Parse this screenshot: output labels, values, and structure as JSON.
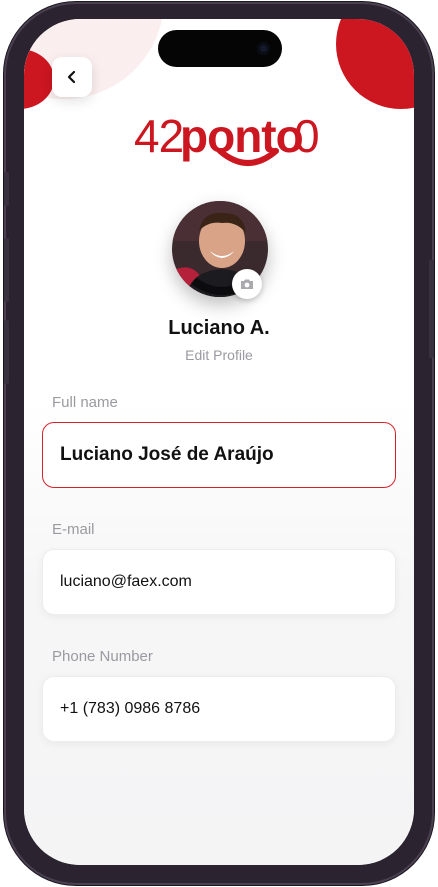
{
  "brand": {
    "logo_number": "42",
    "logo_word": "ponto",
    "logo_suffix": "0",
    "accent_color": "#cc1620"
  },
  "header": {
    "back_icon": "chevron-left-icon"
  },
  "profile": {
    "display_name": "Luciano A.",
    "edit_label": "Edit Profile",
    "camera_icon": "camera-icon"
  },
  "form": {
    "full_name": {
      "label": "Full name",
      "value": "Luciano José de Araújo"
    },
    "email": {
      "label": "E-mail",
      "value": "luciano@faex.com"
    },
    "phone": {
      "label": "Phone Number",
      "value": "+1 (783) 0986 8786"
    }
  }
}
